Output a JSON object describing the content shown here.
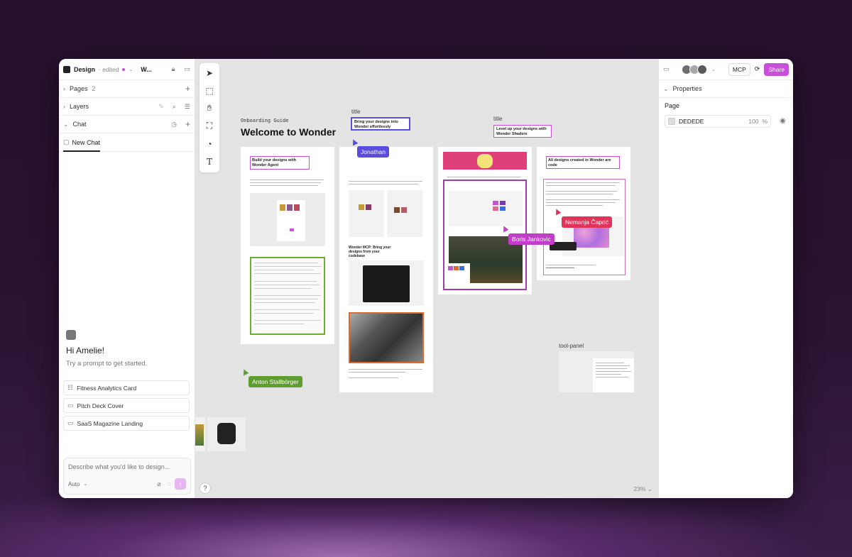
{
  "header": {
    "doc_title": "Design",
    "doc_status": "· edited",
    "doc_title_short": "W..."
  },
  "left_panel": {
    "pages_label": "Pages",
    "pages_count": "2",
    "layers_label": "Layers",
    "chat_label": "Chat",
    "new_chat_tab": "New Chat",
    "greeting": "Hi Amelie!",
    "greeting_sub": "Try a prompt to get started.",
    "prompts": [
      {
        "label": "Fitness Analytics Card"
      },
      {
        "label": "Pitch Deck Cover"
      },
      {
        "label": "SaaS Magazine Landing"
      }
    ],
    "input_placeholder": "Describe what you'd like to design...",
    "mode_label": "Auto"
  },
  "canvas": {
    "onboarding_small": "Onboarding Guide",
    "onboarding_big": "Welcome to Wonder",
    "title_label_1": "title",
    "title_text_1": "Bring your designs into Wonder effortlessly",
    "title_label_2": "title",
    "title_text_2": "Level up your designs with Wonder Shaders",
    "card1_title": "Build your designs with Wonder Agent",
    "card2_mcp_title": "Wonder MCP: Bring your designs from your codebase",
    "card4_title": "All designs created in Wonder are code",
    "tool_panel_label": "tool-panel",
    "cursors": [
      {
        "name": "Jonathan",
        "color": "#5b4ce0"
      },
      {
        "name": "Boris Jankovic",
        "color": "#c03ec8"
      },
      {
        "name": "Nemanja Čaprić",
        "color": "#e0345a"
      },
      {
        "name": "Anton Stallbörger",
        "color": "#5e9e2e"
      }
    ],
    "zoom": "23%",
    "help": "?"
  },
  "right_panel": {
    "mcp_label": "MCP",
    "share_label": "Share",
    "properties_label": "Properties",
    "page_label": "Page",
    "page_color": "DEDEDE",
    "page_opacity": "100",
    "page_opacity_unit": "%"
  },
  "colors": {
    "accent": "#c84fd8",
    "canvas_bg": "#e4e4e4"
  }
}
